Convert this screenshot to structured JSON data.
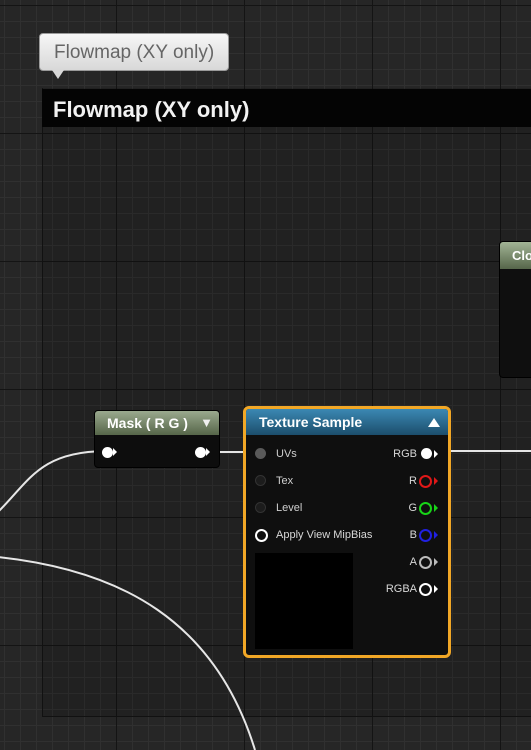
{
  "comment": {
    "bubble_text": "Flowmap (XY only)",
    "title": "Flowmap (XY only)"
  },
  "mask_node": {
    "title": "Mask ( R G )",
    "chevron": "▼"
  },
  "texture_node": {
    "title": "Texture Sample",
    "inputs": [
      "UVs",
      "Tex",
      "Level",
      "Apply View MipBias"
    ],
    "outputs": [
      "RGB",
      "R",
      "G",
      "B",
      "A",
      "RGBA"
    ],
    "output_colors": {
      "RGB": "#ffffff",
      "R": "#e01818",
      "G": "#18d418",
      "B": "#2020e0",
      "A": "#bbbbbb",
      "RGBA": "#ffffff"
    },
    "selected_border_color": "#f1a726"
  },
  "partial_node": {
    "title": "Clo"
  }
}
